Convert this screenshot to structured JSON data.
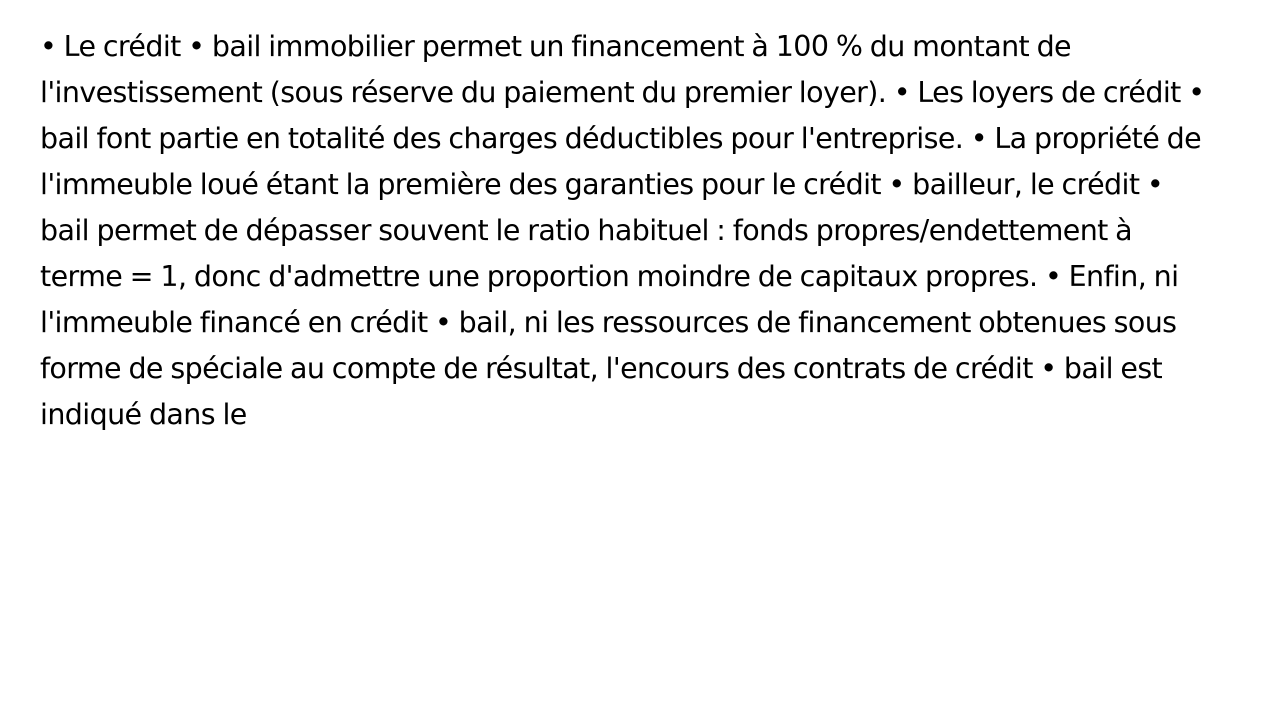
{
  "document": {
    "paragraph": "• Le crédit • bail immobilier permet un financement à 100 % du montant de l'investissement (sous réserve du paiement du premier loyer). • Les loyers de crédit • bail font partie en totalité des charges déductibles pour l'entreprise. • La propriété de l'immeuble loué étant la première des garanties pour le crédit • bailleur, le crédit • bail permet de dépasser souvent le ratio habituel : fonds propres/endettement à terme = 1, donc d'admettre une proportion moindre de capitaux propres. • Enfin, ni l'immeuble financé en crédit • bail, ni les ressources de financement obtenues sous forme de spéciale au compte de résultat, l'encours des contrats de crédit • bail est indiqué dans le"
  },
  "colors": {
    "background": "#ffffff",
    "text": "#000000"
  }
}
